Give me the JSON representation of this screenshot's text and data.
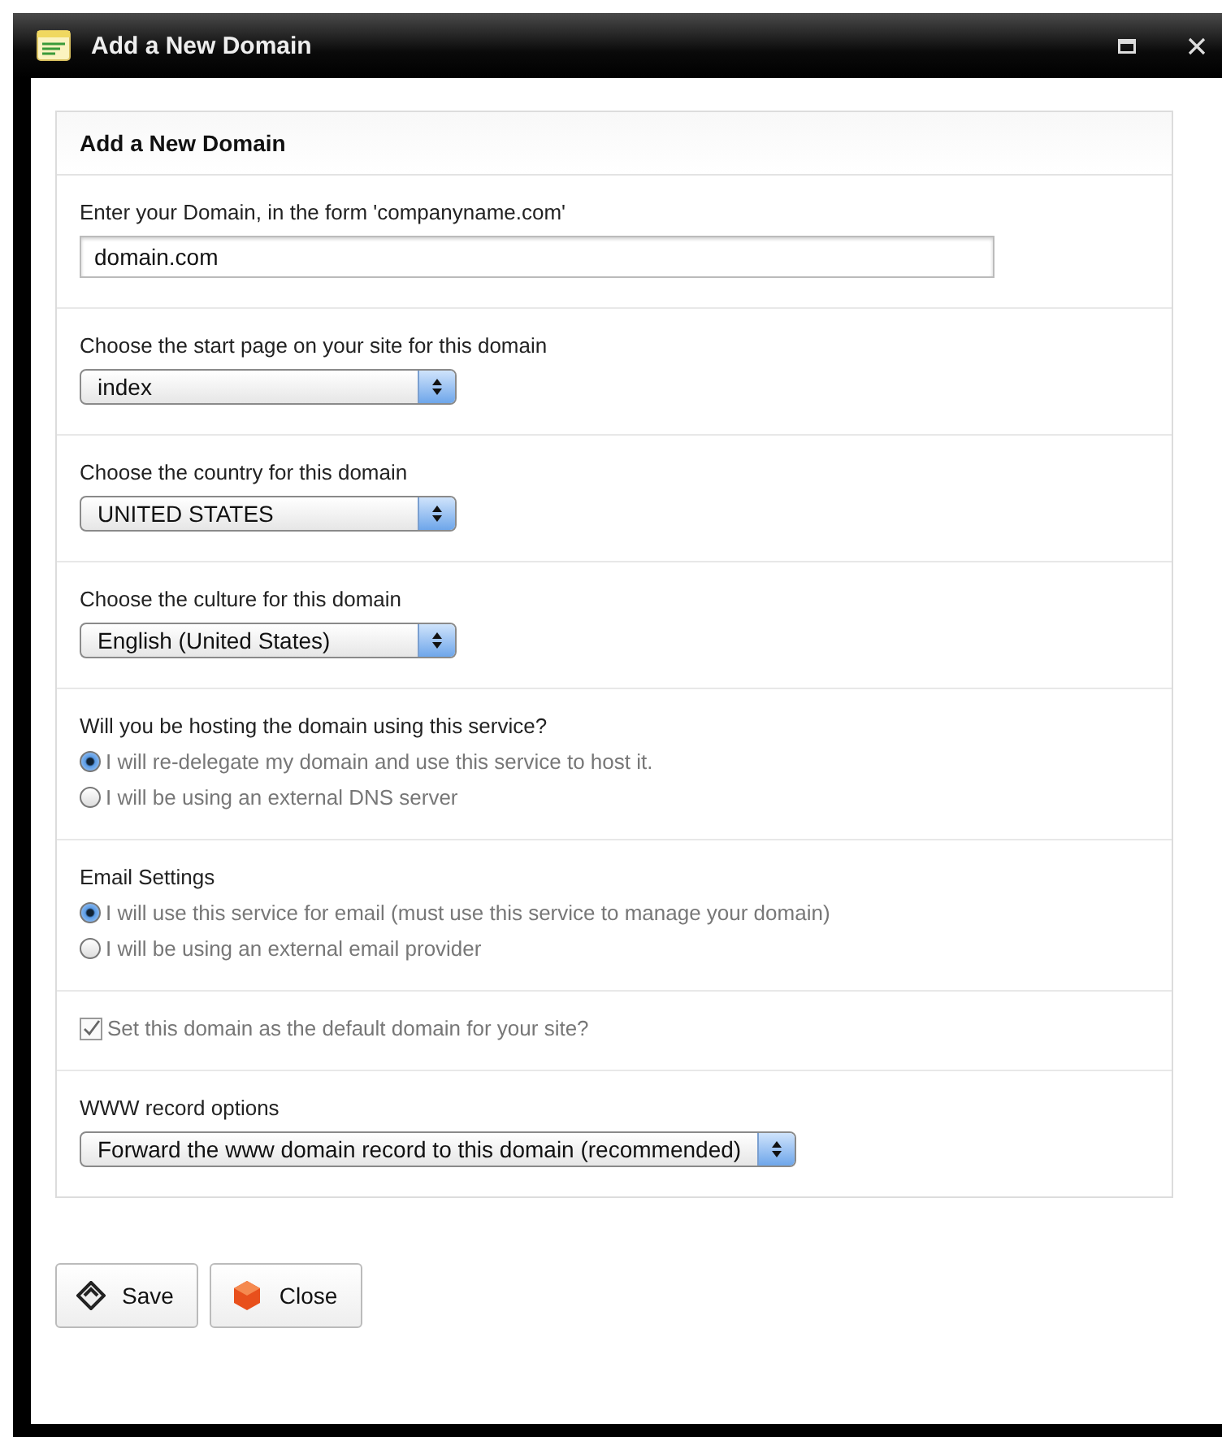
{
  "window": {
    "title": "Add a New Domain"
  },
  "panel": {
    "title": "Add a New Domain"
  },
  "sections": [
    {
      "kind": "text",
      "label": "Enter your Domain, in the form 'companyname.com'",
      "value": "domain.com"
    },
    {
      "kind": "select",
      "label": "Choose the start page on your site for this domain",
      "value": "index"
    },
    {
      "kind": "select",
      "label": "Choose the country for this domain",
      "value": "UNITED STATES"
    },
    {
      "kind": "select",
      "label": "Choose the culture for this domain",
      "value": "English (United States)"
    },
    {
      "kind": "radio",
      "label": "Will you be hosting the domain using this service?",
      "options": [
        {
          "label": "I will re-delegate my domain and use this service to host it.",
          "selected": true
        },
        {
          "label": "I will be using an external DNS server",
          "selected": false
        }
      ]
    },
    {
      "kind": "radio",
      "label": "Email Settings",
      "options": [
        {
          "label": "I will use this service for email (must use this service to manage your domain)",
          "selected": true
        },
        {
          "label": "I will be using an external email provider",
          "selected": false
        }
      ]
    },
    {
      "kind": "checkbox",
      "label": "Set this domain as the default domain for your site?",
      "checked": true
    },
    {
      "kind": "select",
      "label": "WWW record options",
      "value": "Forward the www domain record to this domain (recommended)"
    }
  ],
  "buttons": [
    {
      "kind": "save",
      "label": "Save"
    },
    {
      "kind": "close",
      "label": "Close"
    }
  ]
}
